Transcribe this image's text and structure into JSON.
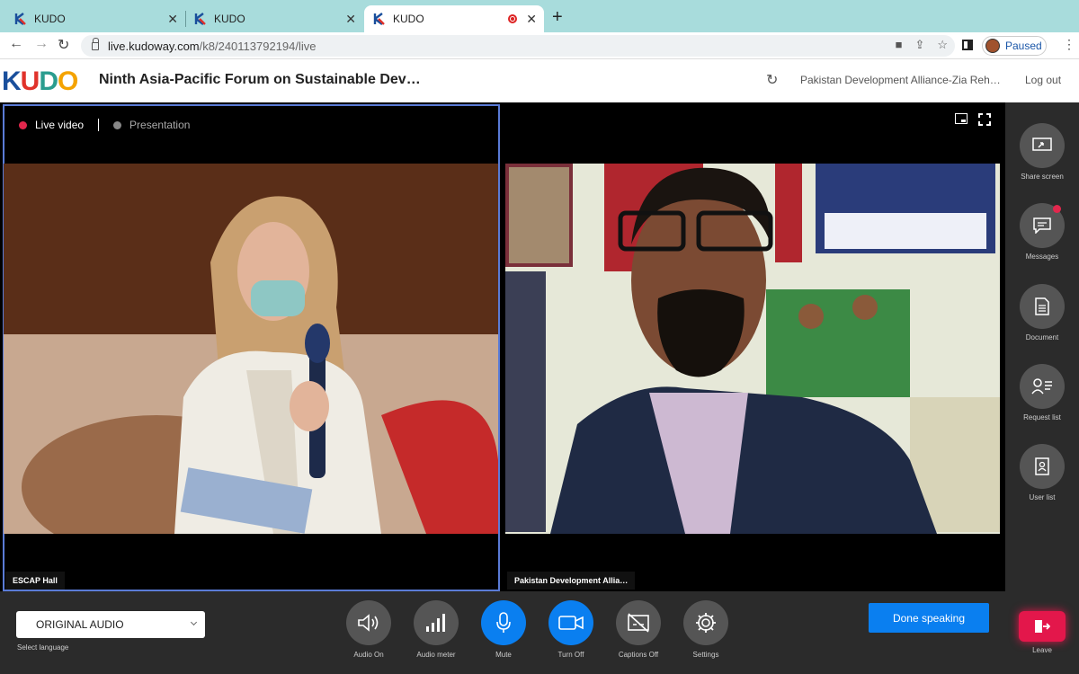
{
  "browser": {
    "tabs": [
      {
        "title": "KUDO"
      },
      {
        "title": "KUDO"
      },
      {
        "title": "KUDO"
      }
    ],
    "url_host": "live.kudoway.com",
    "url_path": "/k8/240113792194/live",
    "profile_status": "Paused"
  },
  "app": {
    "logo_letters": [
      "K",
      "U",
      "D",
      "O"
    ],
    "meeting_title": "Ninth Asia-Pacific Forum on Sustainable Dev…",
    "participant": "Pakistan Development Alliance-Zia Reh…",
    "logout_label": "Log out"
  },
  "stage": {
    "mode_live": "Live video",
    "mode_presentation": "Presentation",
    "left_name": "ESCAP Hall",
    "right_name": "Pakistan Development Allia…"
  },
  "sidebar": {
    "items": [
      {
        "label": "Share screen",
        "icon": "share-screen-icon"
      },
      {
        "label": "Messages",
        "icon": "chat-icon"
      },
      {
        "label": "Document",
        "icon": "document-icon"
      },
      {
        "label": "Request list",
        "icon": "request-list-icon"
      },
      {
        "label": "User list",
        "icon": "user-list-icon"
      }
    ],
    "leave_label": "Leave"
  },
  "controls": {
    "language_value": "ORIGINAL AUDIO",
    "language_label": "Select language",
    "buttons": [
      {
        "label": "Audio On",
        "icon": "speaker-icon",
        "active": false
      },
      {
        "label": "Audio meter",
        "icon": "signal-bars-icon",
        "active": false
      },
      {
        "label": "Mute",
        "icon": "microphone-icon",
        "active": true
      },
      {
        "label": "Turn Off",
        "icon": "camera-icon",
        "active": true
      },
      {
        "label": "Captions Off",
        "icon": "captions-off-icon",
        "active": false
      },
      {
        "label": "Settings",
        "icon": "gear-icon",
        "active": false
      }
    ],
    "done_speaking": "Done speaking"
  },
  "colors": {
    "accent": "#0a7ff0",
    "leave": "#e3174b",
    "live_dot": "#e2274d",
    "panel_border": "#5a7bd6"
  }
}
